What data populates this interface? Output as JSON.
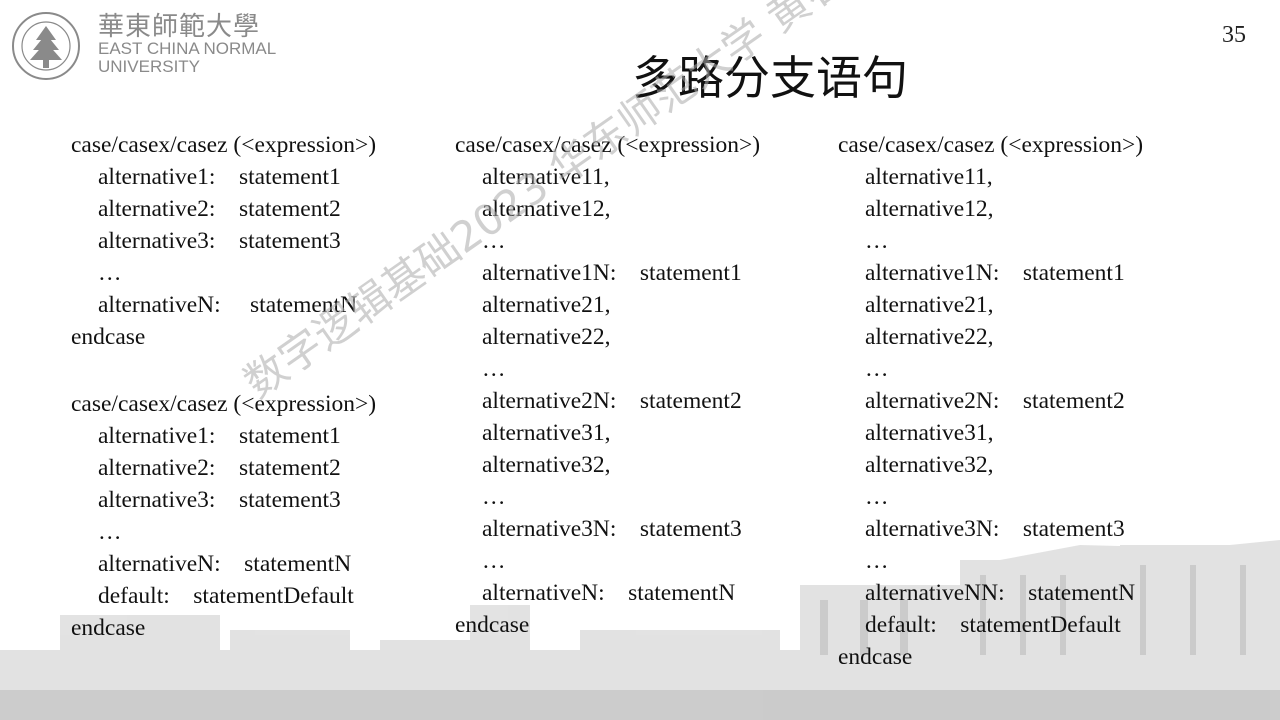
{
  "header": {
    "logo_cn": "華東師範大學",
    "logo_en_line1": "EAST CHINA NORMAL",
    "logo_en_line2": "UNIVERSITY",
    "logo_seal_text": "EAST CHINA NORMAL UNIVERSITY",
    "page_number": "35",
    "title": "多路分支语句"
  },
  "watermark": "数字逻辑基础2023 华东师范大学 黄春晖",
  "columns": [
    {
      "blocks": [
        [
          {
            "text": "case/casex/casez (<expression>)",
            "indent": false
          },
          {
            "text": "alternative1:    statement1",
            "indent": true
          },
          {
            "text": "alternative2:    statement2",
            "indent": true
          },
          {
            "text": "alternative3:    statement3",
            "indent": true
          },
          {
            "text": "…",
            "indent": true
          },
          {
            "text": "alternativeN:     statementN",
            "indent": true
          },
          {
            "text": "endcase",
            "indent": false
          }
        ],
        [
          {
            "text": "case/casex/casez (<expression>)",
            "indent": false
          },
          {
            "text": "alternative1:    statement1",
            "indent": true
          },
          {
            "text": "alternative2:    statement2",
            "indent": true
          },
          {
            "text": "alternative3:    statement3",
            "indent": true
          },
          {
            "text": "…",
            "indent": true
          },
          {
            "text": "alternativeN:    statementN",
            "indent": true
          },
          {
            "text": "default:    statementDefault",
            "indent": true
          },
          {
            "text": "endcase",
            "indent": false
          }
        ]
      ]
    },
    {
      "blocks": [
        [
          {
            "text": "case/casex/casez (<expression>)",
            "indent": false
          },
          {
            "text": "alternative11,",
            "indent": true
          },
          {
            "text": "alternative12,",
            "indent": true
          },
          {
            "text": "…",
            "indent": true
          },
          {
            "text": "alternative1N:    statement1",
            "indent": true
          },
          {
            "text": "alternative21,",
            "indent": true
          },
          {
            "text": "alternative22,",
            "indent": true
          },
          {
            "text": "…",
            "indent": true
          },
          {
            "text": "alternative2N:    statement2",
            "indent": true
          },
          {
            "text": "alternative31,",
            "indent": true
          },
          {
            "text": "alternative32,",
            "indent": true
          },
          {
            "text": "…",
            "indent": true
          },
          {
            "text": "alternative3N:    statement3",
            "indent": true
          },
          {
            "text": "…",
            "indent": true
          },
          {
            "text": "alternativeN:    statementN",
            "indent": true
          },
          {
            "text": "endcase",
            "indent": false
          }
        ]
      ]
    },
    {
      "blocks": [
        [
          {
            "text": "case/casex/casez (<expression>)",
            "indent": false
          },
          {
            "text": "alternative11,",
            "indent": true
          },
          {
            "text": "alternative12,",
            "indent": true
          },
          {
            "text": "…",
            "indent": true
          },
          {
            "text": "alternative1N:    statement1",
            "indent": true
          },
          {
            "text": "alternative21,",
            "indent": true
          },
          {
            "text": "alternative22,",
            "indent": true
          },
          {
            "text": "…",
            "indent": true
          },
          {
            "text": "alternative2N:    statement2",
            "indent": true
          },
          {
            "text": "alternative31,",
            "indent": true
          },
          {
            "text": "alternative32,",
            "indent": true
          },
          {
            "text": "…",
            "indent": true
          },
          {
            "text": "alternative3N:    statement3",
            "indent": true
          },
          {
            "text": "…",
            "indent": true
          },
          {
            "text": "alternativeNN:    statementN",
            "indent": true
          },
          {
            "text": "default:    statementDefault",
            "indent": true
          },
          {
            "text": "endcase",
            "indent": false
          }
        ]
      ]
    }
  ]
}
